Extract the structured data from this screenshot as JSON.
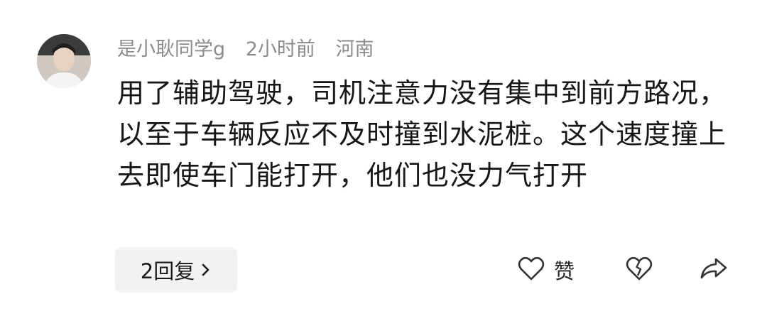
{
  "comment": {
    "author": "是小耿同学g",
    "time": "2小时前",
    "location": "河南",
    "text": "用了辅助驾驶，司机注意力没有集中到前方路况，以至于车辆反应不及时撞到水泥桩。这个速度撞上去即使车门能打开，他们也没力气打开",
    "reply_label": "2回复",
    "like_label": "赞"
  },
  "icons": {
    "avatar": "user-avatar",
    "reply_chevron": "chevron-right-icon",
    "like": "heart-outline-icon",
    "dislike": "broken-heart-icon",
    "share": "share-arrow-icon"
  },
  "colors": {
    "meta_text": "#8c8c8c",
    "body_text": "#161616",
    "reply_bg": "#f2f2f2"
  }
}
